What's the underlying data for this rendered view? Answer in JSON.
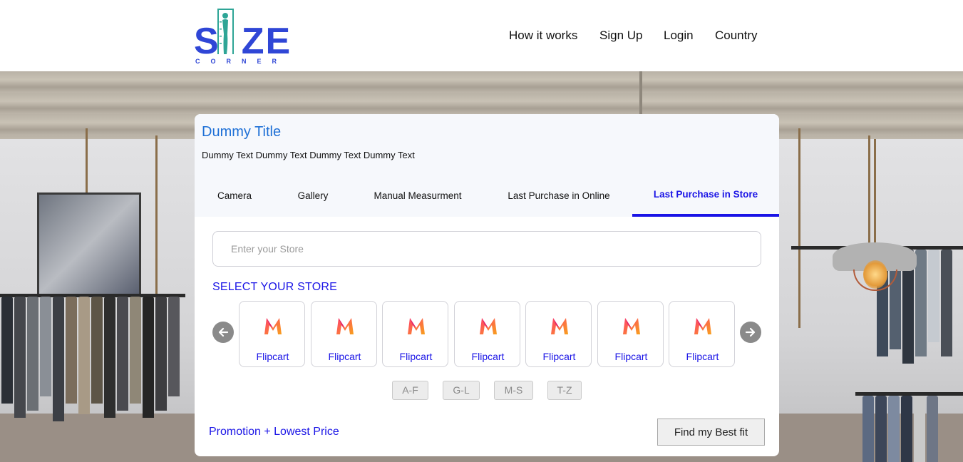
{
  "brand": {
    "logo_text": "SIZE",
    "logo_subtext": "CORNER",
    "logo_color": "#2f46d6",
    "figure_color": "#2ea596"
  },
  "nav": {
    "items": [
      "How it works",
      "Sign Up",
      "Login",
      "Country"
    ]
  },
  "card": {
    "title": "Dummy Title",
    "subtitle": "Dummy Text Dummy Text Dummy Text Dummy Text",
    "tabs": [
      "Camera",
      "Gallery",
      "Manual Measurment",
      "Last Purchase in Online",
      "Last Purchase in Store"
    ],
    "active_tab": "Last Purchase in Store",
    "store_input": {
      "value": "",
      "placeholder": "Enter your Store"
    },
    "select_label": "SELECT YOUR STORE",
    "stores": [
      {
        "name": "Flipcart",
        "icon": "myntra-logo-icon"
      },
      {
        "name": "Flipcart",
        "icon": "myntra-logo-icon"
      },
      {
        "name": "Flipcart",
        "icon": "myntra-logo-icon"
      },
      {
        "name": "Flipcart",
        "icon": "myntra-logo-icon"
      },
      {
        "name": "Flipcart",
        "icon": "myntra-logo-icon"
      },
      {
        "name": "Flipcart",
        "icon": "myntra-logo-icon"
      },
      {
        "name": "Flipcart",
        "icon": "myntra-logo-icon"
      }
    ],
    "carousel": {
      "prev_icon": "arrow-left-icon",
      "next_icon": "arrow-right-icon"
    },
    "alpha_filters": [
      "A-F",
      "G-L",
      "M-S",
      "T-Z"
    ],
    "promo_link": "Promotion + Lowest Price",
    "find_button": "Find my Best fit"
  },
  "colors": {
    "accent": "#1a14e6",
    "title_blue": "#1d6fd6",
    "header_bg": "#f6f8fc"
  }
}
